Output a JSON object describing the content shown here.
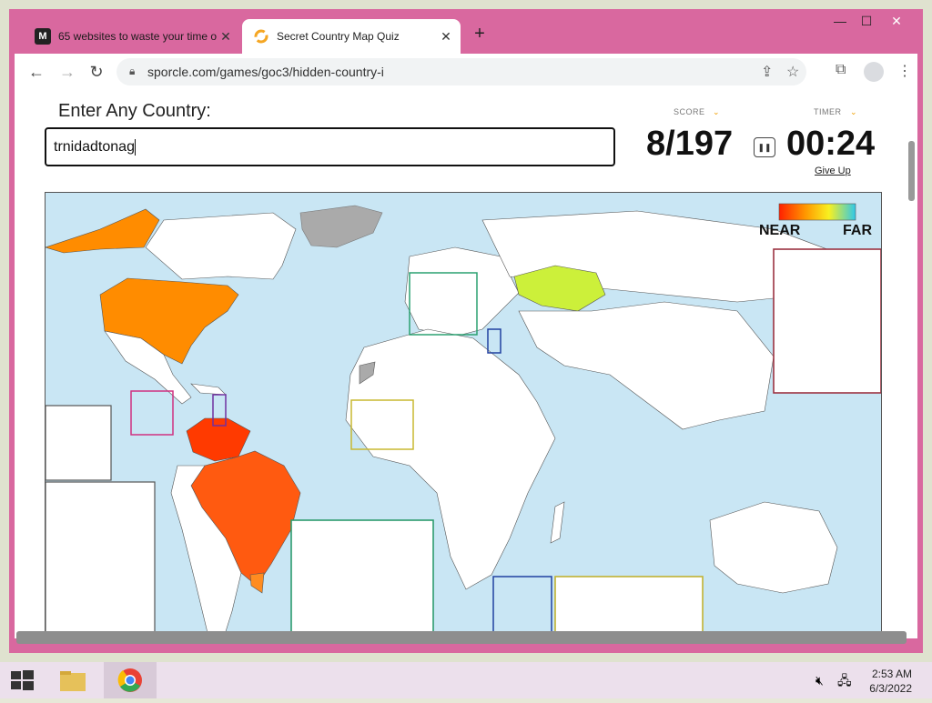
{
  "browser": {
    "tabs": [
      {
        "title": "65 websites to waste your time o",
        "favicon": "M"
      },
      {
        "title": "Secret Country Map Quiz",
        "favicon": "sporcle-icon"
      }
    ],
    "url": "sporcle.com/games/goc3/hidden-country-i"
  },
  "quiz": {
    "prompt": "Enter Any Country:",
    "answer_value": "trnidadtonag",
    "score_label": "SCORE",
    "score": "8/197",
    "timer_label": "TIMER",
    "timer": "00:24",
    "give_up": "Give Up",
    "legend_near": "NEAR",
    "legend_far": "FAR"
  },
  "taskbar": {
    "time": "2:53 AM",
    "date": "6/3/2022"
  },
  "colors": {
    "frame": "#d9689f",
    "near": "#ff3a00",
    "far": "#28c8e0",
    "ocean": "#c9e6f4"
  }
}
